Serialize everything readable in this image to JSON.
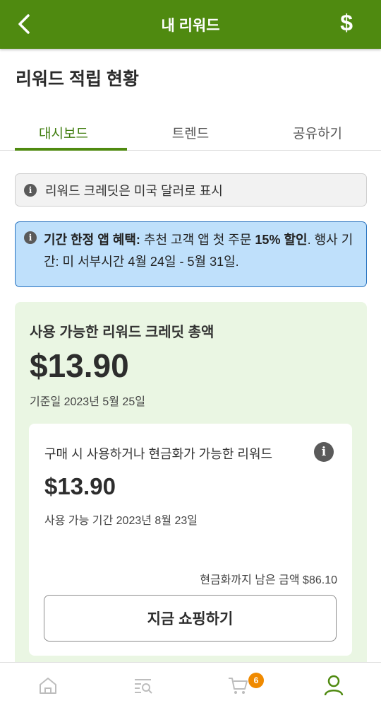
{
  "header": {
    "title": "내 리워드",
    "dollar_symbol": "$"
  },
  "section_title": "리워드 적립 현황",
  "tabs": [
    {
      "label": "대시보드",
      "active": true
    },
    {
      "label": "트렌드",
      "active": false
    },
    {
      "label": "공유하기",
      "active": false
    }
  ],
  "notice": {
    "text": "리워드 크레딧은 미국 달러로 표시"
  },
  "promo": {
    "bold1": "기간 한정 앱 혜택:",
    "text1": " 추천 고객 앱 첫 주문 ",
    "bold2": "15% 할인",
    "text2": ". 행사 기간: 미 서부시간 4월 24일 - 5월 31일."
  },
  "summary": {
    "label": "사용 가능한 리워드 크레딧 총액",
    "amount": "$13.90",
    "as_of": "기준일 2023년 5월 25일"
  },
  "rewards_card": {
    "label": "구매 시 사용하거나 현금화가 가능한 리워드",
    "amount": "$13.90",
    "expiry": "사용 가능 기간 2023년 8월 23일",
    "remaining": "현금화까지 남은 금액 $86.10",
    "shop_button": "지금 쇼핑하기"
  },
  "bottom_nav": {
    "cart_badge": "6",
    "items": [
      "home-icon",
      "browse-icon",
      "cart-icon",
      "account-icon"
    ]
  },
  "colors": {
    "brand_green": "#4f8a10",
    "promo_blue": "#bfe0fb",
    "card_green": "#eaf6e3",
    "badge_orange": "#f08a00"
  }
}
